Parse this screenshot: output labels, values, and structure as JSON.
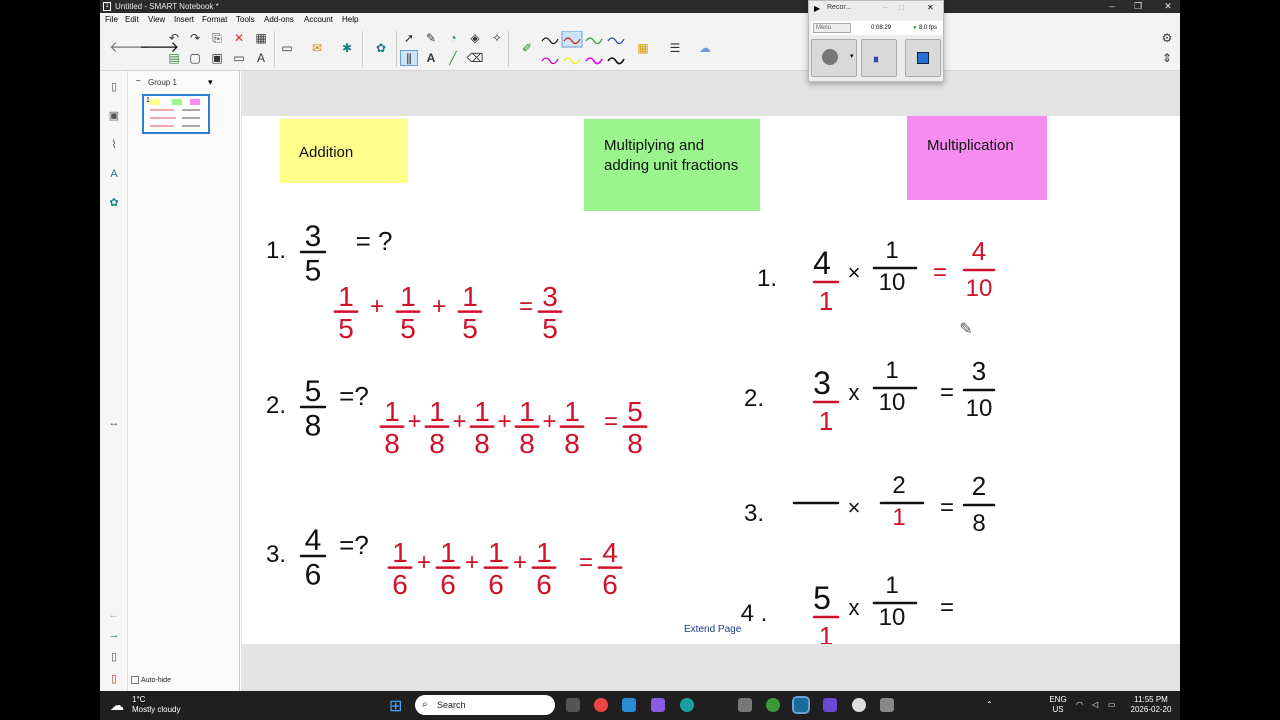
{
  "window": {
    "title": "Untitled - SMART Notebook *",
    "app_icon": "notebook-app-icon",
    "minimize": "–",
    "maximize": "❐",
    "close": "✕"
  },
  "menu": [
    "File",
    "Edit",
    "View",
    "Insert",
    "Format",
    "Tools",
    "Add-ons",
    "Account",
    "Help"
  ],
  "page_panel": {
    "group_label": "Group 1",
    "collapse_glyph": "–",
    "dropdown_glyph": "▾",
    "thumb_number": "1",
    "autohide_label": "Auto-hide"
  },
  "notes": [
    {
      "text": "Addition",
      "color": "#ffff8c"
    },
    {
      "text": "Multiplying and adding unit fractions",
      "color": "#9af58c"
    },
    {
      "text": "Multiplication",
      "color": "#f78cf0"
    }
  ],
  "canvas": {
    "extend_page": "Extend Page",
    "ink_black": "#111111",
    "ink_red": "#d0112b"
  },
  "addition": [
    {
      "num": "1.",
      "a": "3",
      "b": "5",
      "eq": "= ?",
      "sum": [
        "1/5",
        "1/5",
        "1/5"
      ],
      "result": "3/5"
    },
    {
      "num": "2.",
      "a": "5",
      "b": "8",
      "eq": "=?",
      "sum": [
        "1/8",
        "1/8",
        "1/8",
        "1/8",
        "1/8"
      ],
      "result": "5/8"
    },
    {
      "num": "3.",
      "a": "4",
      "b": "6",
      "eq": "=?",
      "sum": [
        "1/6",
        "1/6",
        "1/6",
        "1/6"
      ],
      "result": "4/6"
    }
  ],
  "multiplication": [
    {
      "num": "1.",
      "lhs_num": "4",
      "lhs_den": "1",
      "op": "×",
      "rhs_num": "1",
      "rhs_den": "10",
      "eq": "=",
      "res_num": "4",
      "res_den": "10"
    },
    {
      "num": "2.",
      "lhs_num": "3",
      "lhs_den": "1",
      "op": "x",
      "rhs_num": "1",
      "rhs_den": "10",
      "eq": "=",
      "res_num": "3",
      "res_den": "10"
    },
    {
      "num": "3.",
      "lhs_num": "",
      "lhs_den": "",
      "op": "×",
      "rhs_num": "2",
      "rhs_den": "1",
      "eq": "=",
      "res_num": "2",
      "res_den": "8"
    },
    {
      "num": "4 .",
      "lhs_num": "5",
      "lhs_den": "1",
      "op": "x",
      "rhs_num": "1",
      "rhs_den": "10",
      "eq": "=",
      "res_num": "",
      "res_den": ""
    }
  ],
  "recorder": {
    "title": "Recor...",
    "menu_label": "Menu",
    "time": "0:08:29",
    "fps": "8.0 fps",
    "minimize": "–",
    "maximize": "□",
    "close": "✕"
  },
  "taskbar": {
    "temp": "1°C",
    "weather": "Mostly cloudy",
    "search_placeholder": "Search",
    "lang1": "ENG",
    "lang2": "US",
    "time": "11:55 PM",
    "date": "2026-02-20"
  },
  "sidebar_icons": [
    "page-sorter-icon",
    "gallery-icon",
    "attachments-icon",
    "properties-icon",
    "addons-icon"
  ]
}
